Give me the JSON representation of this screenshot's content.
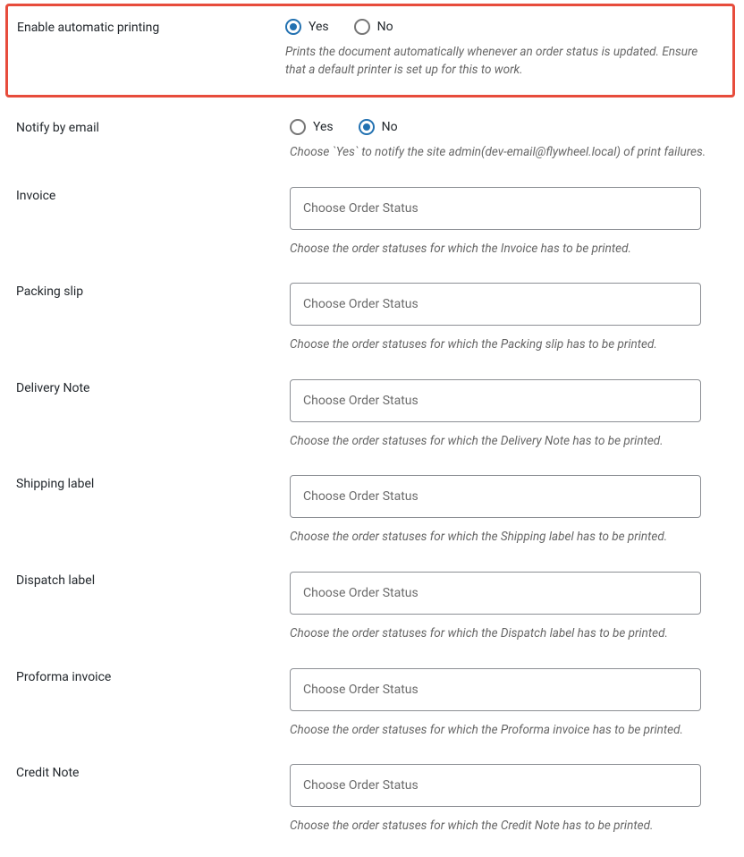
{
  "rows": {
    "enable_auto_printing": {
      "label": "Enable automatic printing",
      "yes": "Yes",
      "no": "No",
      "help": "Prints the document automatically whenever an order status is updated. Ensure that a default printer is set up for this to work."
    },
    "notify_email": {
      "label": "Notify by email",
      "yes": "Yes",
      "no": "No",
      "help": "Choose `Yes` to notify the site admin(dev-email@flywheel.local) of print failures."
    },
    "invoice": {
      "label": "Invoice",
      "placeholder": "Choose Order Status",
      "help": "Choose the order statuses for which the Invoice has to be printed."
    },
    "packing_slip": {
      "label": "Packing slip",
      "placeholder": "Choose Order Status",
      "help": "Choose the order statuses for which the Packing slip has to be printed."
    },
    "delivery_note": {
      "label": "Delivery Note",
      "placeholder": "Choose Order Status",
      "help": "Choose the order statuses for which the Delivery Note has to be printed."
    },
    "shipping_label": {
      "label": "Shipping label",
      "placeholder": "Choose Order Status",
      "help": "Choose the order statuses for which the Shipping label has to be printed."
    },
    "dispatch_label": {
      "label": "Dispatch label",
      "placeholder": "Choose Order Status",
      "help": "Choose the order statuses for which the Dispatch label has to be printed."
    },
    "proforma_invoice": {
      "label": "Proforma invoice",
      "placeholder": "Choose Order Status",
      "help": "Choose the order statuses for which the Proforma invoice has to be printed."
    },
    "credit_note": {
      "label": "Credit Note",
      "placeholder": "Choose Order Status",
      "help": "Choose the order statuses for which the Credit Note has to be printed."
    }
  }
}
